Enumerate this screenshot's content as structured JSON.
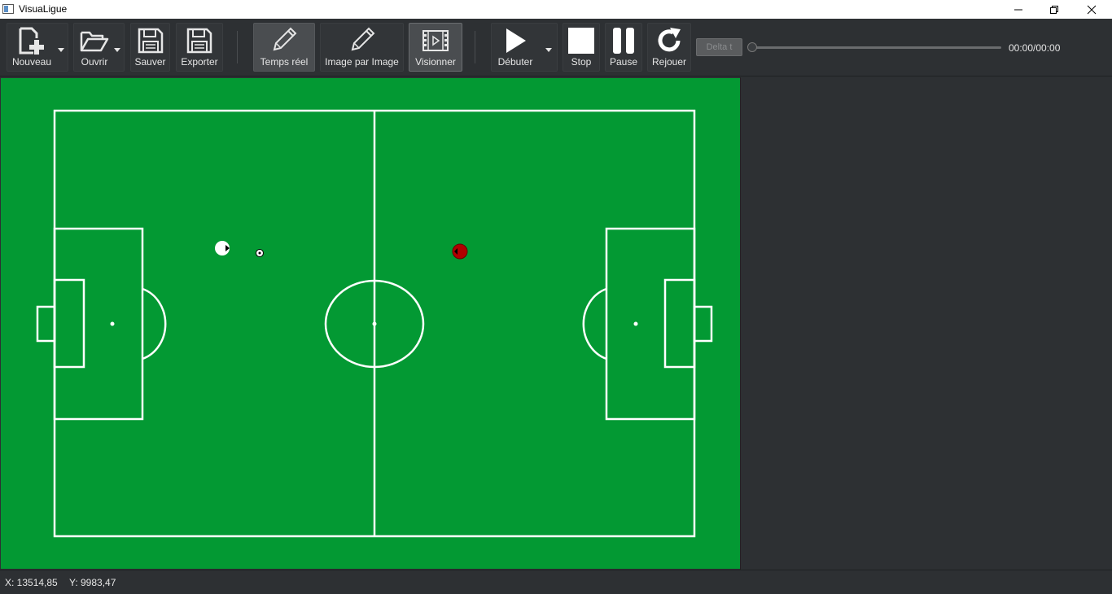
{
  "window": {
    "title": "VisuaLigue"
  },
  "toolbar": {
    "new_label": "Nouveau",
    "open_label": "Ouvrir",
    "save_label": "Sauver",
    "export_label": "Exporter",
    "realtime_label": "Temps réel",
    "frame_label": "Image par Image",
    "view_label": "Visionner",
    "start_label": "Débuter",
    "stop_label": "Stop",
    "pause_label": "Pause",
    "replay_label": "Rejouer",
    "delta_placeholder": "Delta t",
    "time": "00:00/00:00",
    "progress": 0
  },
  "field": {
    "color": "#039933",
    "line_color": "#ffffff",
    "player1_color": "#ffffff",
    "player2_color": "#b00000"
  },
  "status": {
    "x": "X: 13514,85",
    "y": "Y: 9983,47"
  }
}
